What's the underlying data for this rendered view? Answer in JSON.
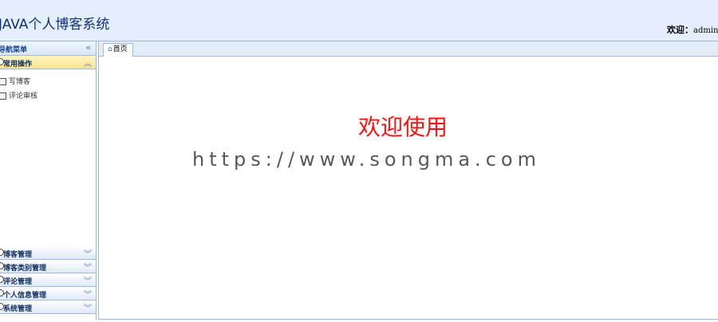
{
  "header": {
    "app_title": "JAVA个人博客系统",
    "welcome_label": "欢迎：",
    "user": "admin"
  },
  "west": {
    "title": "导航菜单",
    "collapse_icon": "double-chevron-left-icon",
    "groups": [
      {
        "label": "常用操作",
        "expanded": true,
        "items": [
          "写博客",
          "评论审核"
        ]
      },
      {
        "label": "博客管理",
        "expanded": false
      },
      {
        "label": "博客类别管理",
        "expanded": false
      },
      {
        "label": "评论管理",
        "expanded": false
      },
      {
        "label": "个人信息管理",
        "expanded": false
      },
      {
        "label": "系统管理",
        "expanded": false
      }
    ]
  },
  "tabs": [
    {
      "label": "首页",
      "icon": "home-icon"
    }
  ],
  "main": {
    "welcome_text": "欢迎使用",
    "watermark": "https://www.songma.com"
  },
  "colors": {
    "header_bg": "#e4eefc",
    "border": "#99bbe8",
    "active_group": "#ffe48d",
    "welcome_text": "#ff1010",
    "title": "#10327a"
  }
}
